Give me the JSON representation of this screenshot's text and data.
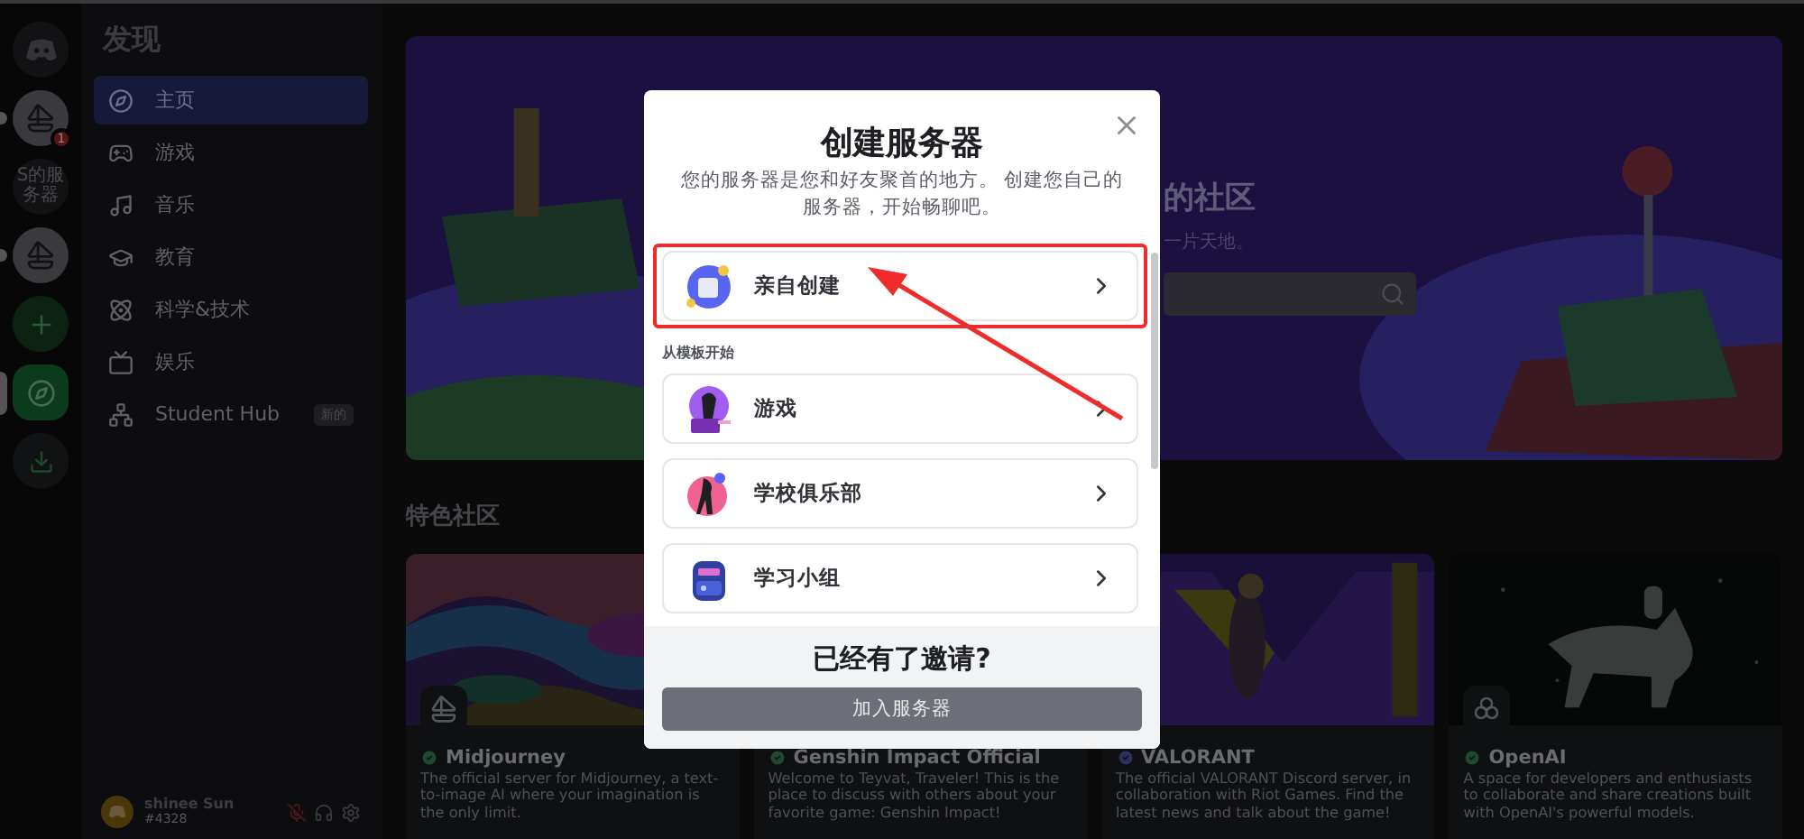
{
  "server_rail": {
    "items": [
      {
        "kind": "home",
        "selected": false,
        "unread": false
      },
      {
        "kind": "server",
        "selected": false,
        "unread": true,
        "badge": "1"
      },
      {
        "kind": "text",
        "selected": false,
        "unread": false,
        "label": "S的服务器"
      },
      {
        "kind": "server",
        "selected": false,
        "unread": true
      },
      {
        "kind": "add",
        "selected": false,
        "unread": false
      },
      {
        "kind": "explore",
        "selected": true,
        "unread": false
      },
      {
        "kind": "download",
        "selected": false,
        "unread": false
      }
    ]
  },
  "sidebar": {
    "title": "发现",
    "items": [
      {
        "label": "主页",
        "selected": true
      },
      {
        "label": "游戏",
        "selected": false
      },
      {
        "label": "音乐",
        "selected": false
      },
      {
        "label": "教育",
        "selected": false
      },
      {
        "label": "科学&技术",
        "selected": false
      },
      {
        "label": "娱乐",
        "selected": false
      },
      {
        "label": "Student Hub",
        "selected": false,
        "badge": "新的"
      }
    ]
  },
  "user_panel": {
    "name": "shinee Sun",
    "tag": "#4328",
    "mic_muted": true
  },
  "hero": {
    "title": "的社区",
    "subtitle": "一片天地。"
  },
  "featured": {
    "heading": "特色社区",
    "cards": [
      {
        "name": "Midjourney",
        "partner": false,
        "logo": true,
        "description": "The official server for Midjourney, a text-to-image AI where your imagination is the only limit."
      },
      {
        "name": "Genshin Impact Official",
        "partner": false,
        "logo": false,
        "description": "Welcome to Teyvat, Traveler! This is the place to discuss with others about your favorite game: Genshin Impact!"
      },
      {
        "name": "VALORANT",
        "partner": true,
        "logo": false,
        "description": "The official VALORANT Discord server, in collaboration with Riot Games. Find the latest news and talk about the game!"
      },
      {
        "name": "OpenAI",
        "partner": false,
        "logo": true,
        "description": "A space for developers and enthusiasts to collaborate and share creations built with OpenAI's powerful models."
      }
    ]
  },
  "modal": {
    "title": "创建服务器",
    "subtitle": "您的服务器是您和好友聚首的地方。 创建您自己的服务器，开始畅聊吧。",
    "primary_option": {
      "label": "亲自创建",
      "highlighted": true
    },
    "template_label": "从模板开始",
    "templates": [
      {
        "label": "游戏"
      },
      {
        "label": "学校俱乐部"
      },
      {
        "label": "学习小组"
      }
    ],
    "footer": {
      "title": "已经有了邀请?",
      "button": "加入服务器"
    }
  }
}
